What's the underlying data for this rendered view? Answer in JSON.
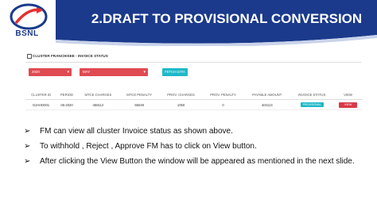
{
  "slide": {
    "title": "2.DRAFT TO PROVISIONAL CONVERSION",
    "logo_text": "BSNL",
    "colors": {
      "header_blue": "#1b3a8c",
      "accent_red": "#e04a52",
      "accent_teal": "#1fb8c8"
    }
  },
  "panel": {
    "title": "CLUSTER FRANCHISEE - INVOICE STATUS",
    "year_select": "2020",
    "month_select": "MAY",
    "fetch_label": "FETCH DATA",
    "columns": [
      "CLUSTER ID",
      "PERIOD",
      "MTCE CHARGES",
      "MTCE PENALTY",
      "PROV. CHARGES",
      "PROV. PENALTY",
      "PAYABLE AMOUNT",
      "INVOICE STATUS",
      "VIEW"
    ],
    "row": {
      "cluster_id": "DJAHD001",
      "period": "05-2020",
      "mtce_charges": "458112",
      "mtce_penalty": "55049",
      "prov_charges": "1050",
      "prov_penalty": "0",
      "payable_amount": "404113",
      "status": "PROVISIONAL",
      "view": "VIEW"
    }
  },
  "bullets": [
    "FM can view all cluster Invoice status as shown above.",
    "To withhold , Reject , Approve FM has to click on View button.",
    "After clicking the View Button the window will be appeared as mentioned in the next slide."
  ]
}
